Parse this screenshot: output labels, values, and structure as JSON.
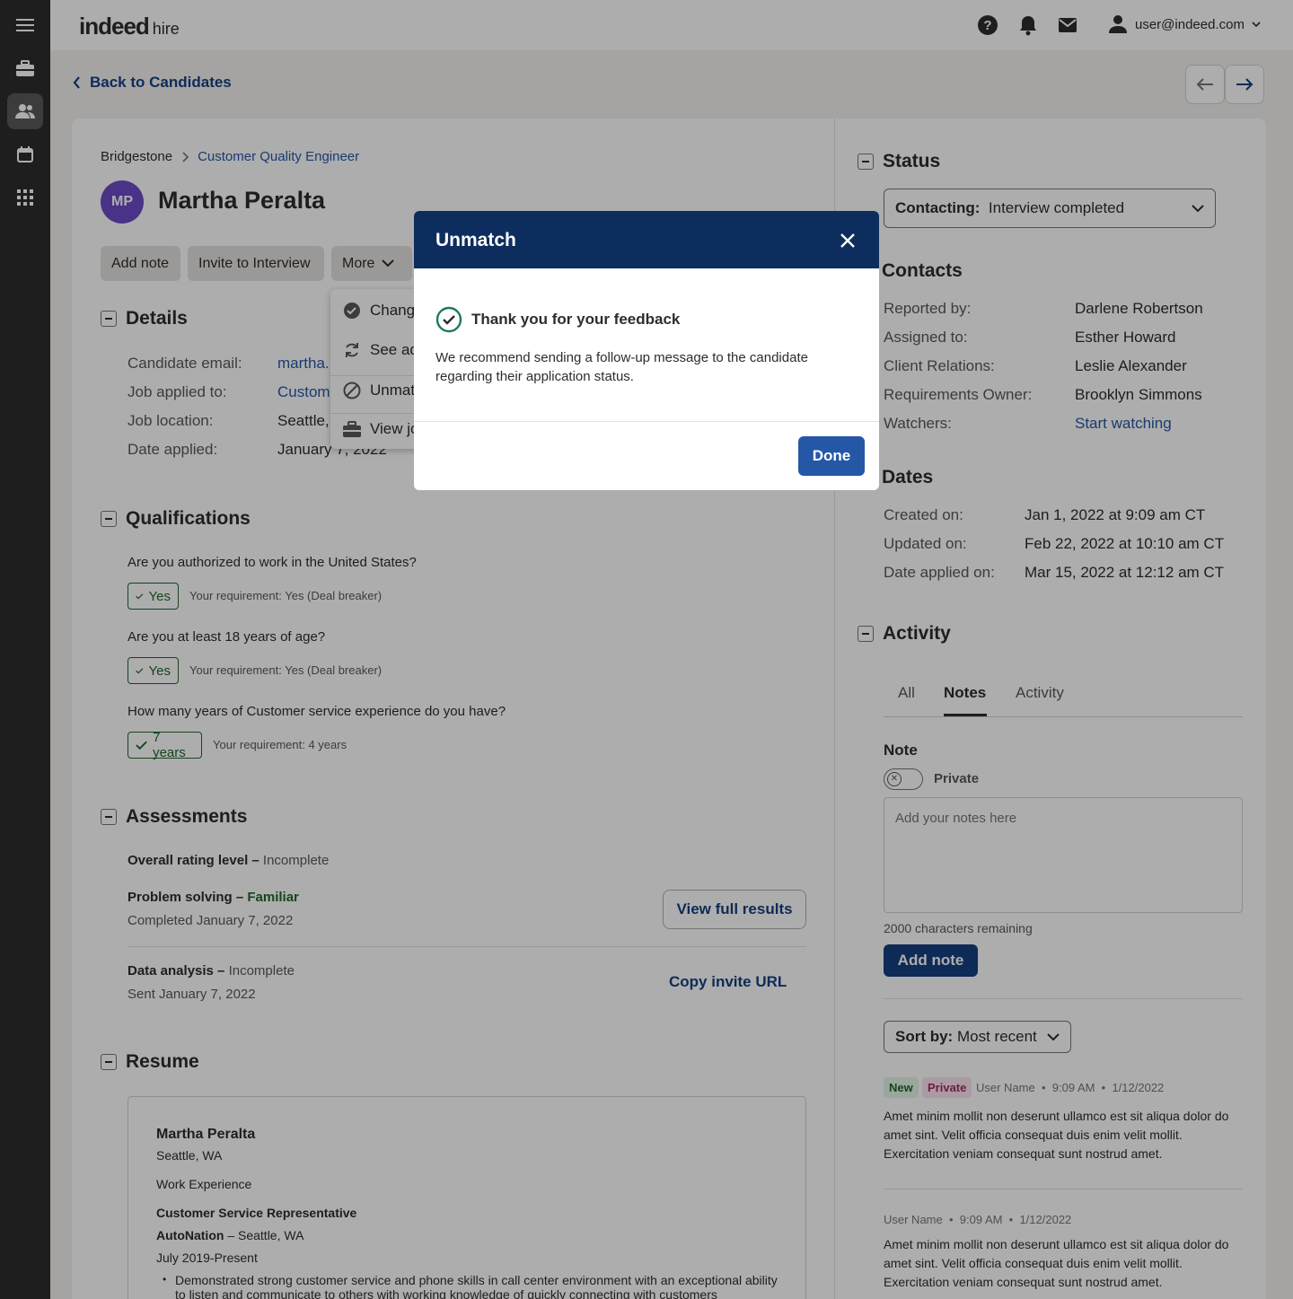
{
  "topbar": {
    "logo_main": "indeed",
    "logo_sub": "hire",
    "user_email": "user@indeed.com"
  },
  "nav": {
    "back_label": "Back to Candidates"
  },
  "candidate": {
    "company": "Bridgestone",
    "job_link": "Customer Quality Engineer",
    "initials": "MP",
    "name": "Martha Peralta"
  },
  "actions": {
    "add_note": "Add note",
    "invite": "Invite to Interview",
    "more": "More"
  },
  "menu": {
    "items": [
      "Chang",
      "See ad",
      "Unmat",
      "View jo"
    ]
  },
  "details": {
    "title": "Details",
    "rows": [
      {
        "label": "Candidate email:",
        "value": "martha."
      },
      {
        "label": "Job applied to:",
        "value": "Custom"
      },
      {
        "label": "Job location:",
        "value": "Seattle,"
      },
      {
        "label": "Date applied:",
        "value": "January 7, 2022"
      }
    ]
  },
  "qualifications": {
    "title": "Qualifications",
    "items": [
      {
        "question": "Are you authorized to work in the United States?",
        "answer": "Yes",
        "requirement": "Your requirement: Yes (Deal breaker)"
      },
      {
        "question": "Are you at least 18 years of age?",
        "answer": "Yes",
        "requirement": "Your requirement: Yes (Deal breaker)"
      },
      {
        "question": "How many years of Customer service experience do you have?",
        "answer": "7 years",
        "requirement": "Your requirement: 4 years"
      }
    ]
  },
  "assessments": {
    "title": "Assessments",
    "overall_label": "Overall rating level –",
    "overall_value": "Incomplete",
    "problem_label": "Problem solving –",
    "problem_value": "Familiar",
    "problem_date": "Completed January 7, 2022",
    "view_results": "View full results",
    "data_label": "Data analysis –",
    "data_value": "Incomplete",
    "data_date": "Sent January 7, 2022",
    "copy_invite": "Copy invite URL"
  },
  "resume": {
    "title": "Resume",
    "name": "Martha Peralta",
    "location": "Seattle, WA",
    "section": "Work Experience",
    "role": "Customer Service Representative",
    "company": "AutoNation",
    "company_location": " – Seattle, WA",
    "dates": "July 2019-Present",
    "bullet": "Demonstrated strong customer service and phone skills in call center environment with an exceptional ability to listen and communicate to others with working knowledge of quickly connecting with customers"
  },
  "status": {
    "title": "Status",
    "select_label": "Contacting:",
    "select_value": "Interview completed"
  },
  "contacts": {
    "title": "Contacts",
    "rows": [
      {
        "label": "Reported by:",
        "value": "Darlene Robertson"
      },
      {
        "label": "Assigned to:",
        "value": "Esther Howard"
      },
      {
        "label": "Client Relations:",
        "value": "Leslie Alexander"
      },
      {
        "label": "Requirements Owner:",
        "value": "Brooklyn Simmons"
      },
      {
        "label": "Watchers:",
        "value": "Start watching"
      }
    ]
  },
  "dates": {
    "title": "Dates",
    "rows": [
      {
        "label": "Created on:",
        "value": "Jan 1, 2022 at 9:09 am CT"
      },
      {
        "label": "Updated on:",
        "value": "Feb 22, 2022 at 10:10 am CT"
      },
      {
        "label": "Date applied on:",
        "value": "Mar 15, 2022 at 12:12 am CT"
      }
    ]
  },
  "activity": {
    "title": "Activity",
    "tabs": [
      "All",
      "Notes",
      "Activity"
    ],
    "note_label": "Note",
    "private_label": "Private",
    "placeholder": "Add your notes here",
    "remaining": "2000 characters remaining",
    "add_note": "Add note",
    "sort_label": "Sort by:",
    "sort_value": "Most recent",
    "notes": [
      {
        "badge_new": "New",
        "badge_private": "Private",
        "user": "User Name",
        "time": "9:09 AM",
        "date": "1/12/2022",
        "body": "Amet minim mollit non deserunt ullamco est sit aliqua dolor do amet sint. Velit officia consequat duis enim velit mollit. Exercitation veniam consequat sunt nostrud amet."
      },
      {
        "user": "User Name",
        "time": "9:09 AM",
        "date": "1/12/2022",
        "body": "Amet minim mollit non deserunt ullamco est sit aliqua dolor do amet sint. Velit officia consequat duis enim velit mollit. Exercitation veniam consequat sunt nostrud amet."
      }
    ]
  },
  "modal": {
    "title": "Unmatch",
    "feedback": "Thank you for your feedback",
    "message": "We recommend sending a follow-up message to the candidate regarding their application status.",
    "done": "Done"
  },
  "colors": {
    "brand_blue": "#164081",
    "link_blue": "#2557a7",
    "modal_header": "#0d2d5e",
    "success_green": "#1f662c",
    "avatar_purple": "#6c4bc7"
  }
}
